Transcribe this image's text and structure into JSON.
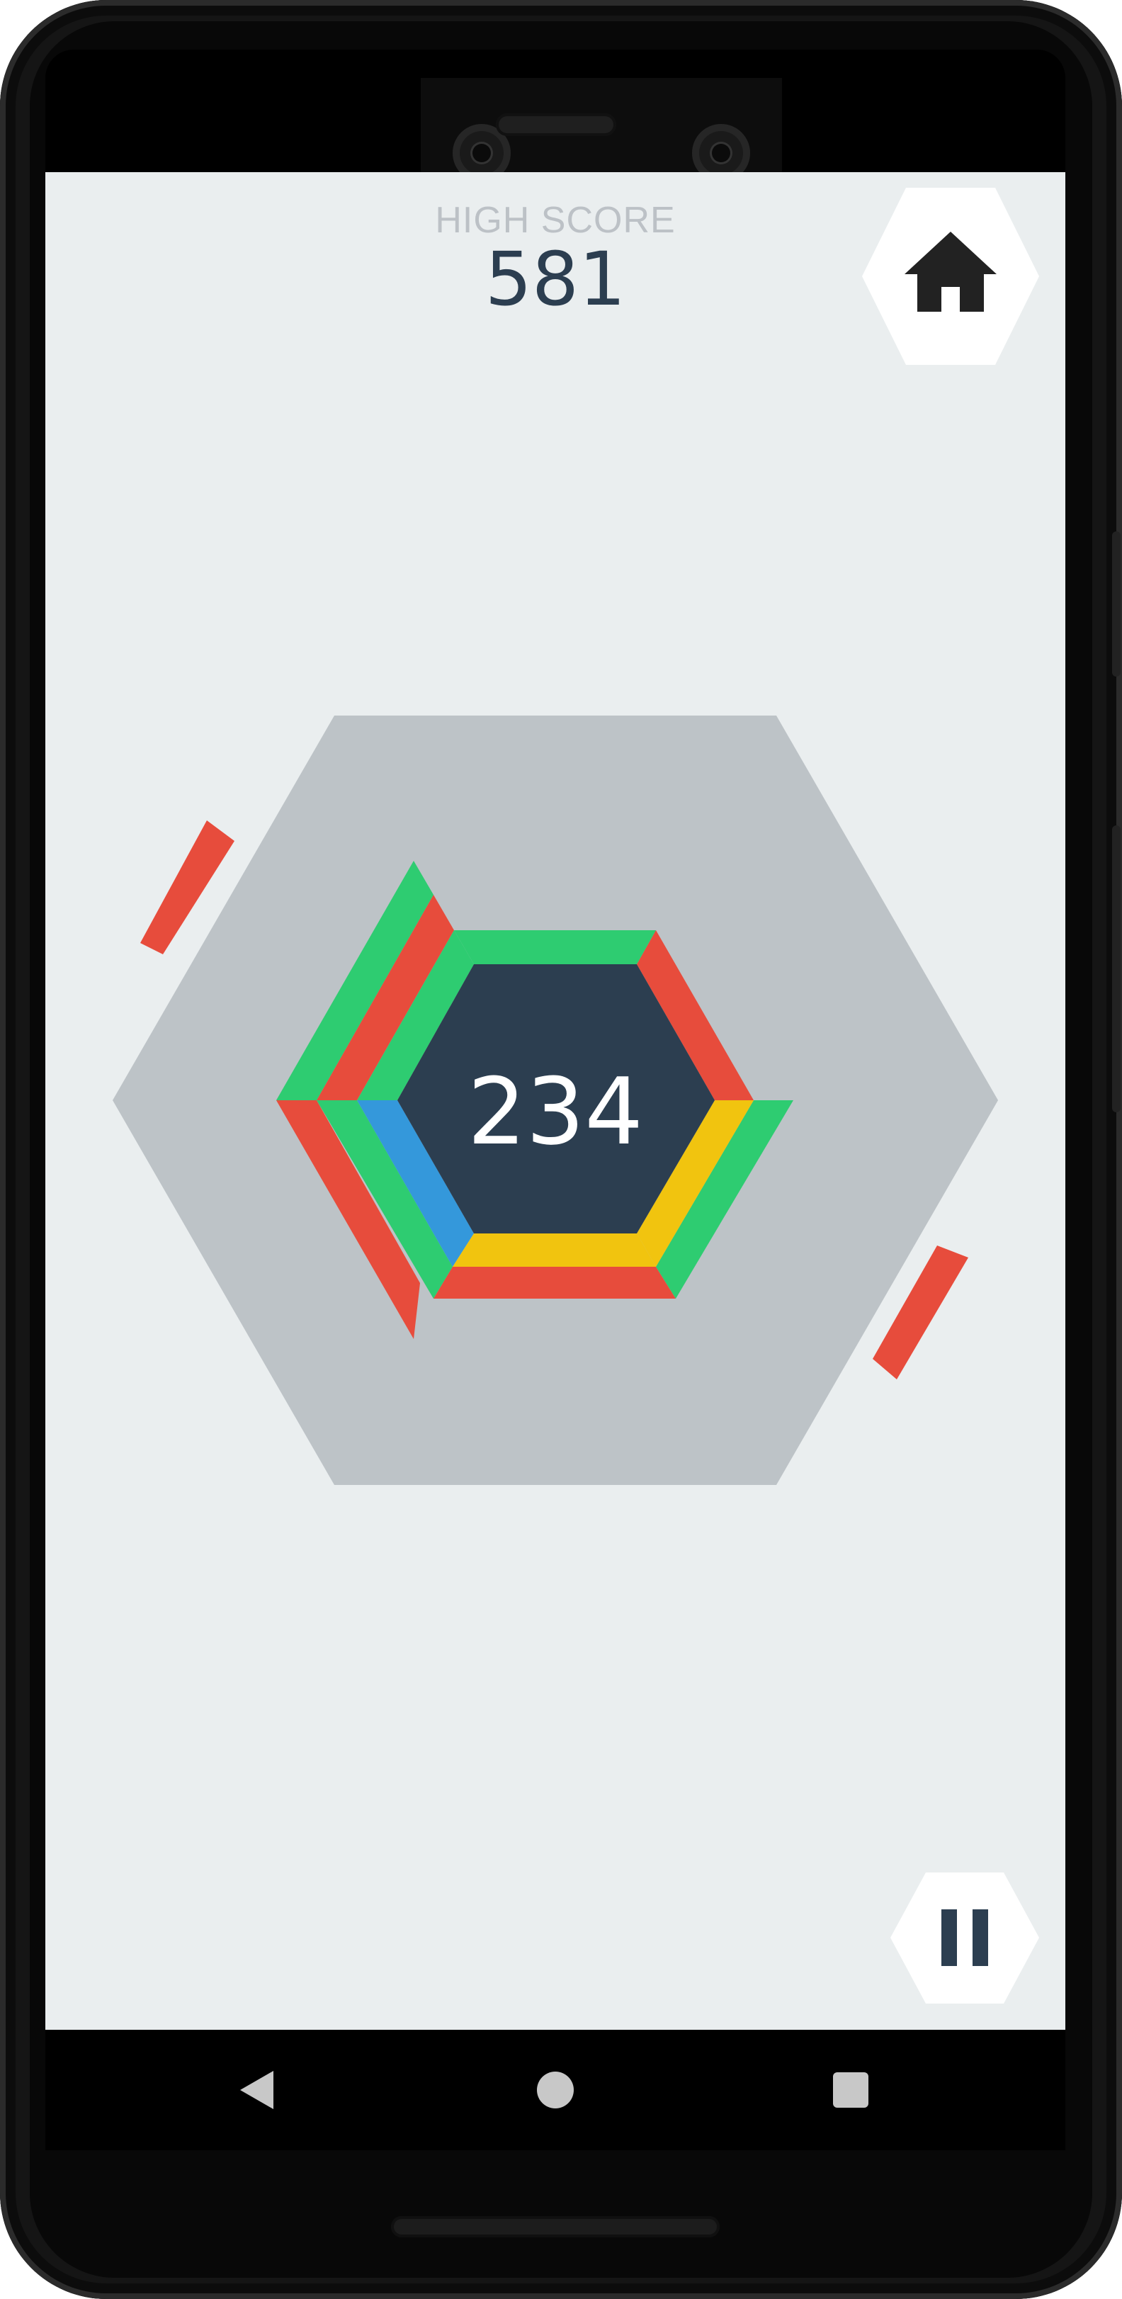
{
  "game": {
    "high_score_label": "HIGH SCORE",
    "high_score_value": "581",
    "current_score": "234",
    "home_icon": "home-icon",
    "pause_icon": "pause-icon"
  },
  "colors": {
    "background": "#eaeeef",
    "board_hex": "#bdc3c7",
    "center_hex": "#2c3e50",
    "red": "#e74c3c",
    "green": "#2ecc71",
    "yellow": "#f1c40f",
    "blue": "#3498db"
  },
  "navigation": {
    "back_icon": "back-triangle-icon",
    "home_icon": "home-circle-icon",
    "recents_icon": "recents-square-icon"
  }
}
